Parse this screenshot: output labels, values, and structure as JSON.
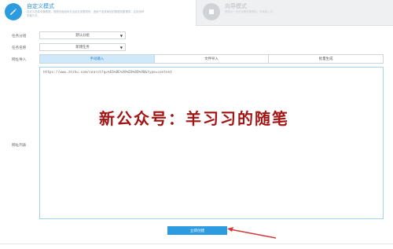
{
  "modes": {
    "active": {
      "title": "自定义模式",
      "desc": "自定义选择采集数据，根据页面结构灵活设定采集规则，适用于各类网站的数据采集需求，支持多种采集方式。"
    },
    "inactive": {
      "title": "向导模式",
      "desc": "按提示一步步设置采集规则，简单易上手。"
    }
  },
  "form": {
    "group_label": "任务分组",
    "group_value": "默认分组",
    "name_label": "任务名称",
    "name_value": "新建任务",
    "url_label": "网址导入",
    "tabs": [
      {
        "label": "手动输入",
        "active": true
      },
      {
        "label": "文件导入",
        "active": false
      },
      {
        "label": "批量生成",
        "active": false
      }
    ],
    "url_area_label": "网址列表",
    "url_value": "https://www.zhihu.com/search?q=%E6%8E%A8%E8%8D%90&type=content",
    "watermark": "新公众号：羊习习的随笔",
    "submit_label": "立即创建"
  },
  "colors": {
    "accent": "#2d9be0",
    "watermark": "#a31414",
    "arrow": "#d23a3a"
  }
}
